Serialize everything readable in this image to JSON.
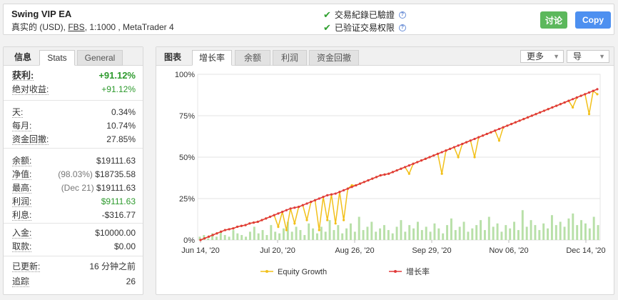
{
  "header": {
    "title": "Swing VIP EA",
    "subtitle_pre": "真实的 (USD), ",
    "broker": "FBS",
    "subtitle_post": ", 1:1000 , MetaTrader 4",
    "verified_1": "交易紀錄已驗證",
    "verified_2": "已验证交易权限",
    "discuss_label": "讨论",
    "copy_label": "Copy"
  },
  "left_tabs": {
    "info": "信息",
    "stats": "Stats",
    "general": "General"
  },
  "stats": {
    "group1": [
      {
        "label": "获利:",
        "value": "+91.12%"
      },
      {
        "label": "绝对收益:",
        "value": "+91.12%"
      }
    ],
    "group2": [
      {
        "label": "天:",
        "value": "0.34%"
      },
      {
        "label": "每月:",
        "value": "10.74%"
      },
      {
        "label": "资金回撤:",
        "value": "27.85%"
      }
    ],
    "group3": [
      {
        "label": "余额:",
        "value": "$19111.63"
      },
      {
        "label": "净值:",
        "note": "(98.03%)",
        "value": "$18735.58"
      },
      {
        "label": "最高:",
        "note": "(Dec 21)",
        "value": "$19111.63"
      },
      {
        "label": "利润:",
        "value": "$9111.63"
      },
      {
        "label": "利息:",
        "value": "-$316.77"
      }
    ],
    "group4": [
      {
        "label": "入金:",
        "value": "$10000.00"
      },
      {
        "label": "取款:",
        "value": "$0.00"
      }
    ],
    "group5": [
      {
        "label": "已更新:",
        "value": "16 分钟之前"
      },
      {
        "label": "追踪",
        "value": "26"
      }
    ]
  },
  "right_tabs": {
    "chart": "图表",
    "growth": "增长率",
    "balance": "余额",
    "profit": "利润",
    "drawdown": "资金回撤",
    "more": "更多",
    "export": "导"
  },
  "colors": {
    "equity": "#f2c01a",
    "growth": "#e03a3a",
    "bars": "#b8e0a8"
  },
  "chart_data": {
    "type": "line",
    "x_labels": [
      "Jun 14, '20",
      "Jul 20, '20",
      "Aug 26, '20",
      "Sep 29, '20",
      "Nov 06, '20",
      "Dec 14, '20"
    ],
    "y_ticks": [
      "0%",
      "25%",
      "50%",
      "75%",
      "100%"
    ],
    "ylim": [
      0,
      100
    ],
    "series": [
      {
        "name": "增长率",
        "values": [
          0,
          1,
          2,
          3,
          4,
          5,
          6,
          6.5,
          7,
          8,
          8.5,
          9,
          10,
          10.5,
          11,
          12,
          13,
          14,
          15,
          16,
          17,
          18,
          19,
          19.5,
          20,
          21,
          22,
          23,
          24,
          25,
          26,
          27,
          27.5,
          28,
          29,
          30,
          31,
          32,
          33,
          34,
          35,
          36,
          37,
          38,
          39,
          39.5,
          40,
          41,
          42,
          43,
          44,
          45,
          46,
          47,
          48,
          49,
          50,
          51,
          52,
          53,
          54,
          55,
          56,
          57,
          58,
          59,
          60,
          61,
          62,
          63,
          64,
          65,
          66,
          67,
          68,
          69,
          70,
          71,
          72,
          73,
          74,
          75,
          76,
          77,
          78,
          79,
          80,
          81,
          82,
          83,
          84,
          85,
          86,
          87,
          88,
          89,
          90,
          91
        ]
      },
      {
        "name": "Equity Growth",
        "values": [
          0,
          1,
          2,
          3,
          4,
          5,
          6,
          6.5,
          7,
          8,
          8.5,
          9,
          10,
          10.5,
          11,
          12,
          13,
          14,
          15,
          8,
          17,
          6,
          19,
          10,
          20,
          21,
          12,
          23,
          24,
          6,
          26,
          12,
          27.5,
          10,
          29,
          12,
          31,
          33,
          33,
          34,
          35,
          36,
          37,
          38,
          39,
          39.5,
          40,
          41,
          42,
          43,
          44,
          40,
          46,
          47,
          48,
          49,
          50,
          51,
          52,
          40,
          54,
          55,
          56,
          50,
          58,
          59,
          60,
          50,
          62,
          63,
          64,
          65,
          66,
          60,
          68,
          69,
          70,
          71,
          72,
          73,
          74,
          75,
          76,
          77,
          78,
          79,
          80,
          81,
          82,
          83,
          84,
          80,
          86,
          87,
          88,
          76,
          90,
          88
        ]
      }
    ],
    "bars": [
      2,
      3,
      1,
      4,
      2,
      5,
      3,
      2,
      6,
      4,
      3,
      2,
      5,
      8,
      4,
      6,
      3,
      9,
      5,
      4,
      7,
      11,
      5,
      8,
      6,
      3,
      10,
      7,
      4,
      8,
      5,
      12,
      6,
      9,
      4,
      7,
      10,
      5,
      14,
      6,
      8,
      11,
      5,
      7,
      9,
      6,
      4,
      8,
      12,
      5,
      9,
      7,
      11,
      6,
      8,
      5,
      10,
      7,
      4,
      9,
      13,
      6,
      8,
      11,
      5,
      7,
      9,
      12,
      6,
      14,
      8,
      10,
      5,
      9,
      7,
      11,
      6,
      18,
      8,
      12,
      9,
      6,
      10,
      7,
      15,
      9,
      11,
      8,
      13,
      16,
      9,
      12,
      10,
      7,
      14,
      9
    ]
  },
  "legend": {
    "equity": "Equity Growth",
    "growth": "增长率"
  }
}
